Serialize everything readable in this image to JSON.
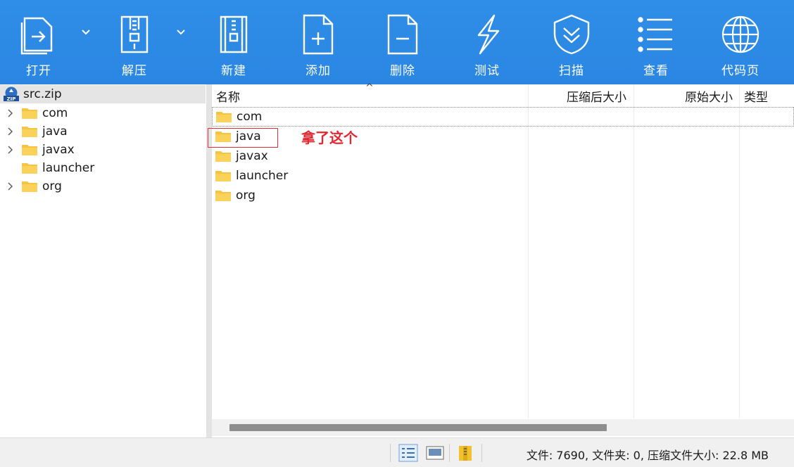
{
  "toolbar": {
    "buttons": [
      {
        "label": "打开",
        "icon": "open-icon"
      },
      {
        "label": "解压",
        "icon": "extract-icon"
      },
      {
        "label": "新建",
        "icon": "new-archive-icon"
      },
      {
        "label": "添加",
        "icon": "add-file-icon"
      },
      {
        "label": "删除",
        "icon": "delete-file-icon"
      },
      {
        "label": "测试",
        "icon": "test-bolt-icon"
      },
      {
        "label": "扫描",
        "icon": "scan-shield-icon"
      },
      {
        "label": "查看",
        "icon": "view-list-icon"
      },
      {
        "label": "代码页",
        "icon": "codepage-globe-icon"
      }
    ]
  },
  "tree": {
    "root": "src.zip",
    "items": [
      {
        "label": "com",
        "expandable": true
      },
      {
        "label": "java",
        "expandable": true
      },
      {
        "label": "javax",
        "expandable": true
      },
      {
        "label": "launcher",
        "expandable": false
      },
      {
        "label": "org",
        "expandable": true
      }
    ]
  },
  "list": {
    "columns": {
      "name": "名称",
      "compressed": "压缩后大小",
      "original": "原始大小",
      "type": "类型"
    },
    "rows": [
      {
        "name": "com"
      },
      {
        "name": "java"
      },
      {
        "name": "javax"
      },
      {
        "name": "launcher"
      },
      {
        "name": "org"
      }
    ]
  },
  "annotation": "拿了这个",
  "status": {
    "text": "文件: 7690, 文件夹: 0, 压缩文件大小: 22.8 MB"
  },
  "colors": {
    "toolbar": "#2a86e2",
    "folder": "#f6c343",
    "annotation": "#e3262f"
  }
}
